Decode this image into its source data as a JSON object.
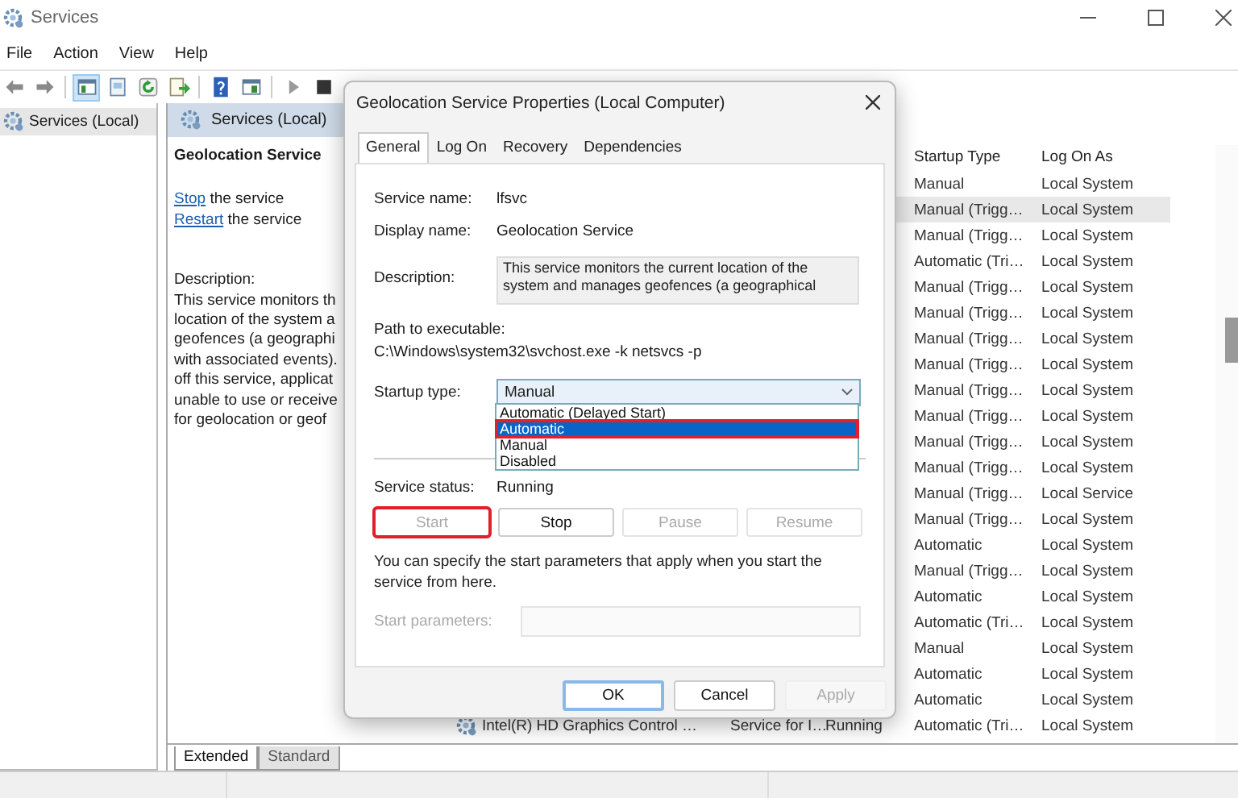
{
  "window": {
    "title": "Services"
  },
  "menu": [
    "File",
    "Action",
    "View",
    "Help"
  ],
  "toolbar": [
    {
      "kind": "back",
      "selected": false
    },
    {
      "kind": "forward",
      "selected": false
    },
    {
      "kind": "tree",
      "selected": true
    },
    {
      "kind": "properties",
      "selected": false
    },
    {
      "kind": "refresh",
      "selected": false
    },
    {
      "kind": "export",
      "selected": false
    },
    {
      "kind": "help",
      "selected": false
    },
    {
      "kind": "pane",
      "selected": false
    },
    {
      "kind": "play",
      "selected": false
    },
    {
      "kind": "stop",
      "selected": false
    }
  ],
  "tree": [
    {
      "label": "Services (Local)",
      "selected": true
    }
  ],
  "details": {
    "header": "Services (Local)",
    "service_name": "Geolocation Service",
    "actions": [
      {
        "link": "Stop",
        "text": "the service"
      },
      {
        "link": "Restart",
        "text": "the service"
      }
    ],
    "description_label": "Description:",
    "description_lines": [
      "This service monitors th",
      "location of the system a",
      "geofences (a geographi",
      "with associated events).",
      "off this service, applicat",
      "unable to use or receive",
      "for geolocation or geof"
    ]
  },
  "list": {
    "columns": [
      "Startup Type",
      "Log On As"
    ],
    "rows": [
      {
        "startup_type": "Manual",
        "log_on_as": "Local System",
        "selected": false
      },
      {
        "startup_type": "Manual (Trigg…",
        "log_on_as": "Local System",
        "selected": true
      },
      {
        "startup_type": "Manual (Trigg…",
        "log_on_as": "Local System",
        "selected": false
      },
      {
        "startup_type": "Automatic (Tri…",
        "log_on_as": "Local System",
        "selected": false
      },
      {
        "startup_type": "Manual (Trigg…",
        "log_on_as": "Local System",
        "selected": false
      },
      {
        "startup_type": "Manual (Trigg…",
        "log_on_as": "Local System",
        "selected": false
      },
      {
        "startup_type": "Manual (Trigg…",
        "log_on_as": "Local System",
        "selected": false
      },
      {
        "startup_type": "Manual (Trigg…",
        "log_on_as": "Local System",
        "selected": false
      },
      {
        "startup_type": "Manual (Trigg…",
        "log_on_as": "Local System",
        "selected": false
      },
      {
        "startup_type": "Manual (Trigg…",
        "log_on_as": "Local System",
        "selected": false
      },
      {
        "startup_type": "Manual (Trigg…",
        "log_on_as": "Local System",
        "selected": false
      },
      {
        "startup_type": "Manual (Trigg…",
        "log_on_as": "Local System",
        "selected": false
      },
      {
        "startup_type": "Manual (Trigg…",
        "log_on_as": "Local Service",
        "selected": false
      },
      {
        "startup_type": "Manual (Trigg…",
        "log_on_as": "Local System",
        "selected": false
      },
      {
        "startup_type": "Automatic",
        "log_on_as": "Local System",
        "selected": false
      },
      {
        "startup_type": "Manual (Trigg…",
        "log_on_as": "Local System",
        "selected": false
      },
      {
        "startup_type": "Automatic",
        "log_on_as": "Local System",
        "selected": false
      },
      {
        "startup_type": "Automatic (Tri…",
        "log_on_as": "Local System",
        "selected": false
      },
      {
        "startup_type": "Manual",
        "log_on_as": "Local System",
        "selected": false
      },
      {
        "startup_type": "Automatic",
        "log_on_as": "Local System",
        "selected": false
      },
      {
        "startup_type": "Automatic",
        "log_on_as": "Local System",
        "selected": false
      },
      {
        "name": "Intel(R) HD Graphics Control …",
        "description": "Service for I…",
        "status": "Running",
        "startup_type": "Automatic (Tri…",
        "log_on_as": "Local System",
        "selected": false
      }
    ]
  },
  "view_tabs": [
    {
      "label": "Extended",
      "selected": true
    },
    {
      "label": "Standard",
      "selected": false
    }
  ],
  "dialog": {
    "title": "Geolocation Service Properties (Local Computer)",
    "tabs": [
      {
        "label": "General",
        "selected": true
      },
      {
        "label": "Log On",
        "selected": false
      },
      {
        "label": "Recovery",
        "selected": false
      },
      {
        "label": "Dependencies",
        "selected": false
      }
    ],
    "fields": [
      {
        "label": "Service name:",
        "value": "lfsvc"
      },
      {
        "label": "Display name:",
        "value": "Geolocation Service"
      }
    ],
    "description": {
      "label": "Description:",
      "lines": [
        "This service monitors the current location of the",
        "system and manages geofences (a geographical"
      ]
    },
    "path": {
      "label": "Path to executable:",
      "value": "C:\\Windows\\system32\\svchost.exe -k netsvcs -p"
    },
    "startup_type": {
      "label": "Startup type:",
      "value": "Manual",
      "expanded": true,
      "options": [
        {
          "label": "Automatic (Delayed Start)",
          "highlighted": false,
          "annotated": false
        },
        {
          "label": "Automatic",
          "highlighted": true,
          "annotated": true
        },
        {
          "label": "Manual",
          "highlighted": false,
          "annotated": false
        },
        {
          "label": "Disabled",
          "highlighted": false,
          "annotated": false
        }
      ]
    },
    "service_status": {
      "label": "Service status:",
      "value": "Running"
    },
    "control_buttons": [
      {
        "label": "Start",
        "disabled": true,
        "annotated": true
      },
      {
        "label": "Stop",
        "disabled": false,
        "annotated": false
      },
      {
        "label": "Pause",
        "disabled": true,
        "annotated": false
      },
      {
        "label": "Resume",
        "disabled": true,
        "annotated": false
      }
    ],
    "hint": "You can specify the start parameters that apply when you start the service from here.",
    "start_parameters": {
      "label": "Start parameters:",
      "disabled": true
    },
    "buttons": [
      {
        "label": "OK",
        "default": true,
        "disabled": false
      },
      {
        "label": "Cancel",
        "default": false,
        "disabled": false
      },
      {
        "label": "Apply",
        "default": false,
        "disabled": true
      }
    ]
  }
}
